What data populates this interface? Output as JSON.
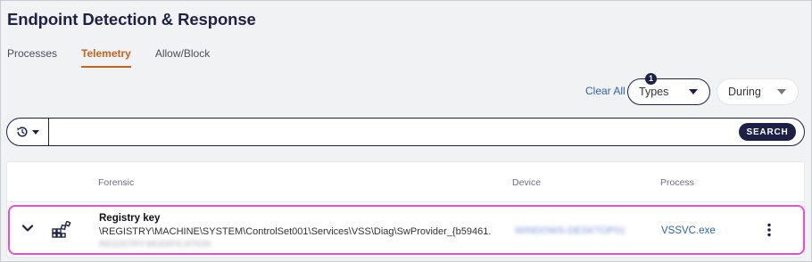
{
  "page": {
    "title": "Endpoint Detection & Response"
  },
  "tabs": [
    {
      "label": "Processes",
      "active": false
    },
    {
      "label": "Telemetry",
      "active": true
    },
    {
      "label": "Allow/Block",
      "active": false
    }
  ],
  "filters": {
    "clear_all": "Clear All",
    "types": {
      "label": "Types",
      "count": "1"
    },
    "during": {
      "label": "During"
    }
  },
  "search": {
    "value": "",
    "placeholder": "",
    "button": "SEARCH",
    "history_icon": "history-icon"
  },
  "table": {
    "columns": {
      "forensic": "Forensic",
      "device": "Device",
      "process": "Process"
    },
    "rows": [
      {
        "title": "Registry key",
        "path": "\\REGISTRY\\MACHINE\\SYSTEM\\ControlSet001\\Services\\VSS\\Diag\\SwProvider_{b59461...",
        "subtitle_redacted": "REGISTRY-MODIFICATION",
        "device_redacted": "WINDOWS-DESKTOP01",
        "process": "VSSVC.exe",
        "icon": "registry-icon"
      }
    ]
  },
  "colors": {
    "accent": "#c4621f",
    "navy": "#1d2145",
    "link": "#2f62a7",
    "highlight": "#e84fcf"
  }
}
